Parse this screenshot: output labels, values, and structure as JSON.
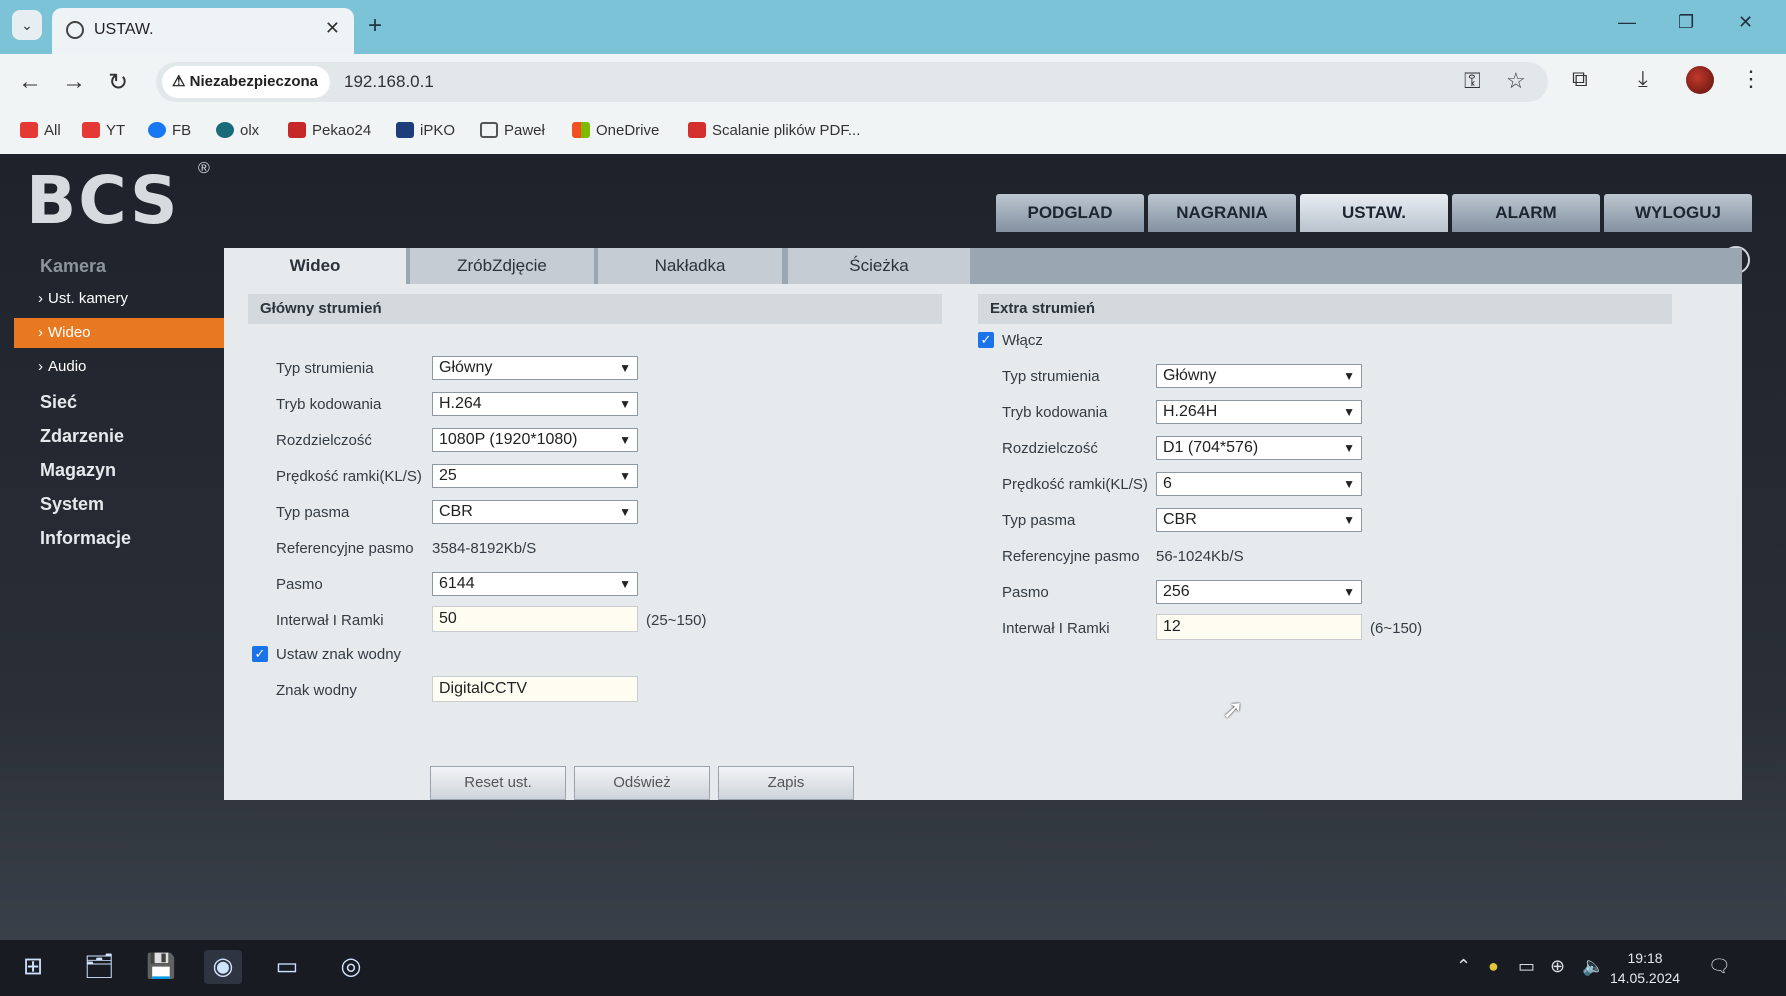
{
  "browser": {
    "tab_title": "USTAW.",
    "security_label": "Niezabezpieczona",
    "url": "192.168.0.1",
    "bookmarks": [
      {
        "label": "All",
        "color": "#e53935"
      },
      {
        "label": "YT",
        "color": "#e53935"
      },
      {
        "label": "FB",
        "color": "#1877f2"
      },
      {
        "label": "olx",
        "color": "#1a6b7a"
      },
      {
        "label": "Pekao24",
        "color": "#c62828"
      },
      {
        "label": "iPKO",
        "color": "#1c3d7a"
      },
      {
        "label": "Paweł",
        "color": "#555555"
      },
      {
        "label": "OneDrive",
        "color": "#0078d4"
      },
      {
        "label": "Scalanie plików PDF...",
        "color": "#d32f2f"
      }
    ]
  },
  "app": {
    "logo": "BCS",
    "logo_mark": "®",
    "topnav": [
      "PODGLAD",
      "NAGRANIA",
      "USTAW.",
      "ALARM",
      "WYLOGUJ"
    ],
    "help": "?",
    "sidebar": {
      "camera": "Kamera",
      "cam_settings": "Ust. kamery",
      "video": "Wideo",
      "audio": "Audio",
      "network": "Sieć",
      "events": "Zdarzenie",
      "storage": "Magazyn",
      "system": "System",
      "info": "Informacje"
    },
    "tabs": [
      "Wideo",
      "ZróbZdjęcie",
      "Nakładka",
      "Ścieżka"
    ],
    "main": {
      "header": "Główny strumień",
      "type_label": "Typ strumienia",
      "type_value": "Główny",
      "codec_label": "Tryb kodowania",
      "codec_value": "H.264",
      "res_label": "Rozdzielczość",
      "res_value": "1080P (1920*1080)",
      "fps_label": "Prędkość ramki(KL/S)",
      "fps_value": "25",
      "bw_type_label": "Typ pasma",
      "bw_type_value": "CBR",
      "ref_label": "Referencyjne pasmo",
      "ref_value": "3584-8192Kb/S",
      "bw_label": "Pasmo",
      "bw_value": "6144",
      "iframe_label": "Interwał I Ramki",
      "iframe_value": "50",
      "iframe_range": "(25~150)",
      "watermark_check_label": "Ustaw znak wodny",
      "watermark_label": "Znak wodny",
      "watermark_value": "DigitalCCTV"
    },
    "extra": {
      "header": "Extra strumień",
      "enable_label": "Włącz",
      "type_label": "Typ strumienia",
      "type_value": "Główny",
      "codec_label": "Tryb kodowania",
      "codec_value": "H.264H",
      "res_label": "Rozdzielczość",
      "res_value": "D1 (704*576)",
      "fps_label": "Prędkość ramki(KL/S)",
      "fps_value": "6",
      "bw_type_label": "Typ pasma",
      "bw_type_value": "CBR",
      "ref_label": "Referencyjne pasmo",
      "ref_value": "56-1024Kb/S",
      "bw_label": "Pasmo",
      "bw_value": "256",
      "iframe_label": "Interwał I Ramki",
      "iframe_value": "12",
      "iframe_range": "(6~150)"
    },
    "buttons": {
      "reset": "Reset ust.",
      "refresh": "Odśwież",
      "save": "Zapis"
    }
  },
  "taskbar": {
    "time": "19:18",
    "date": "14.05.2024"
  }
}
